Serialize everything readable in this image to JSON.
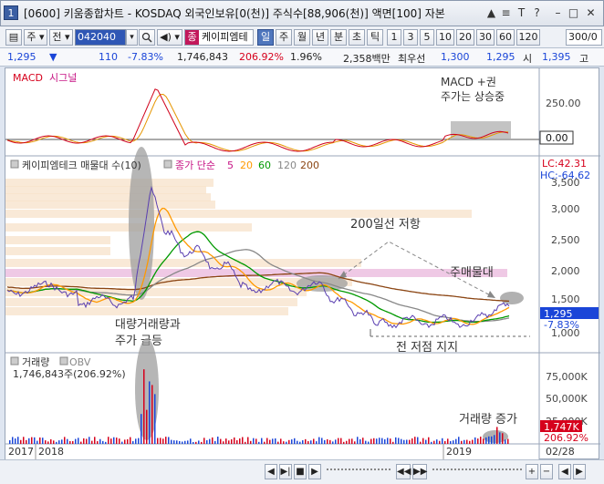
{
  "window": {
    "title": "[0600] 키움종합차트 - KOSDAQ 외국인보유[0(천)] 주식수[88,906(천)] 액면[100] 자본",
    "icon_label": "1",
    "title_buttons": [
      "▲",
      "≡",
      "T",
      "?",
      "–",
      "□",
      "✕"
    ]
  },
  "toolbar": {
    "menu_label": "▤",
    "market_label": "주",
    "all_label": "전",
    "stock_code": "042040",
    "stock_name": "케이피엠테",
    "stock_badge": "종",
    "periods": [
      "일",
      "주",
      "월",
      "년",
      "분",
      "초",
      "틱"
    ],
    "selected_period": "일",
    "intervals": [
      "1",
      "3",
      "5",
      "10",
      "20",
      "30",
      "60",
      "120"
    ],
    "count_value": "300/0"
  },
  "quote": {
    "price": "1,295",
    "change_arrow": "▼",
    "change": "110",
    "change_pct": "-7.83%",
    "volume": "1,746,843",
    "vol_ratio": "206.92%",
    "turnover": "1.96%",
    "amount": "2,358백만",
    "priority_label": "최우선",
    "bid": "1,300",
    "ask": "1,295",
    "open_label": "시",
    "open": "1,395",
    "high_label": "고"
  },
  "colors": {
    "price": "#1a45d8",
    "volume_up": "#d6001c",
    "volume_down": "#1a45d8",
    "ma5": "#c71585",
    "ma20": "#ff9900",
    "ma60": "#009900",
    "ma120": "#888888",
    "ma200": "#8b4513",
    "macd": "#d0021b",
    "signal": "#e69500",
    "obv": "#888888",
    "band": "#f7e1c9",
    "band_pink": "#e9b7dc"
  },
  "macd_panel": {
    "legend_macd": "MACD",
    "legend_signal": "시그널",
    "note_line1": "MACD +권",
    "note_line2": "주가는 상승중",
    "axis_labels": [
      "250.00",
      "0.00"
    ]
  },
  "price_panel": {
    "legend_title": "케이피엠테크 매물대 수(10)",
    "legend_ma_label": "종가 단순",
    "ma_periods": [
      "5",
      "20",
      "60",
      "120",
      "200"
    ],
    "lc_label": "LC:42.31",
    "hc_label": "HC:-64.62",
    "axis_labels": [
      "3,500",
      "3,000",
      "2,500",
      "2,000",
      "1,500",
      "1,000"
    ],
    "current_price_label": "1,295",
    "current_change_label": "-7.83%",
    "annotations": {
      "resistance": "200일선 저항",
      "main_band": "주매물대",
      "volume_surge_line1": "대량거래량과",
      "volume_surge_line2": "주가 급등",
      "support": "전 저점 지지"
    }
  },
  "volume_panel": {
    "legend_volume": "거래량",
    "legend_obv": "OBV",
    "volume_text": "1,746,843주(206.92%)",
    "axis_labels": [
      "75,000K",
      "50,000K",
      "25,000K"
    ],
    "current_volume_label": "1,747K",
    "current_pct_label": "206.92%",
    "annotation": "거래량 증가"
  },
  "x_axis": {
    "labels": [
      "2017",
      "2018",
      "2019"
    ],
    "date_label": "02/28"
  },
  "bottom_bar": {
    "buttons": [
      "◀",
      "▶|",
      "■",
      "▶",
      "◀◀",
      "▶▶",
      "+",
      "−",
      "◀",
      "▶"
    ]
  }
}
